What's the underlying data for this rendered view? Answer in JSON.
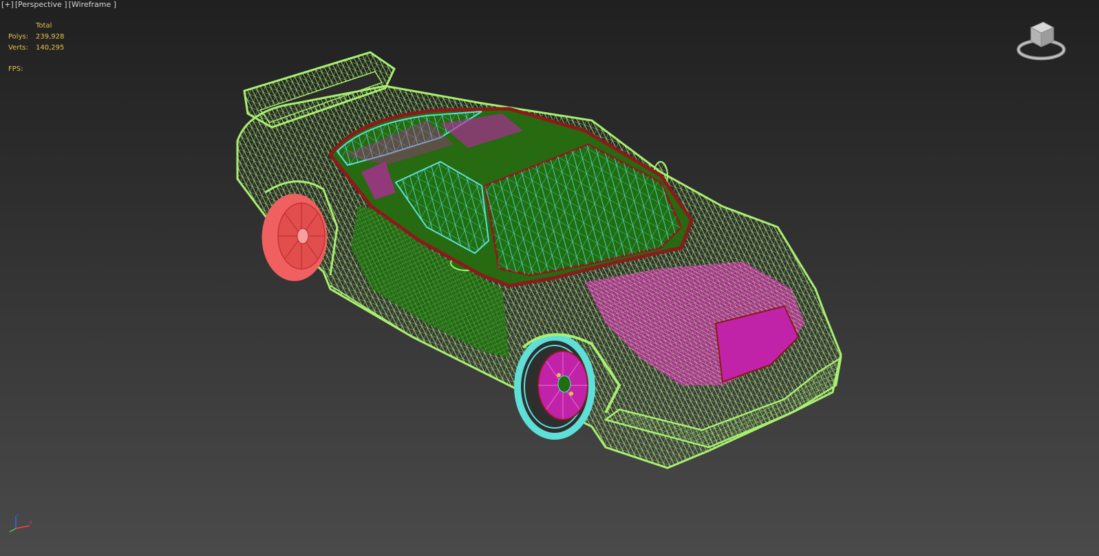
{
  "viewport": {
    "labels": [
      "[+]",
      "[Perspective ]",
      "[Wireframe ]"
    ]
  },
  "stats": {
    "header": "Total",
    "polys_label": "Polys:",
    "polys_value": "239,928",
    "verts_label": "Verts:",
    "verts_value": "140,295",
    "fps_label": "FPS:"
  },
  "viewcube": {
    "icon": "viewcube-icon"
  },
  "axis_gizmo": {
    "icon": "axis-gizmo-icon",
    "axes": [
      "z",
      "x"
    ]
  },
  "colors": {
    "body_wire": "#a8f070",
    "cabin_wire": "#8b1a1a",
    "glass_wire": "#5ee0d8",
    "interior_fill": "#1f6e10",
    "magenta": "#c023a8",
    "rear_wheel": "#f06060",
    "front_tire": "#5ee0d8",
    "front_rim": "#c023a8",
    "stats_text": "#e8c24a",
    "label_text": "#d8d8d8"
  }
}
